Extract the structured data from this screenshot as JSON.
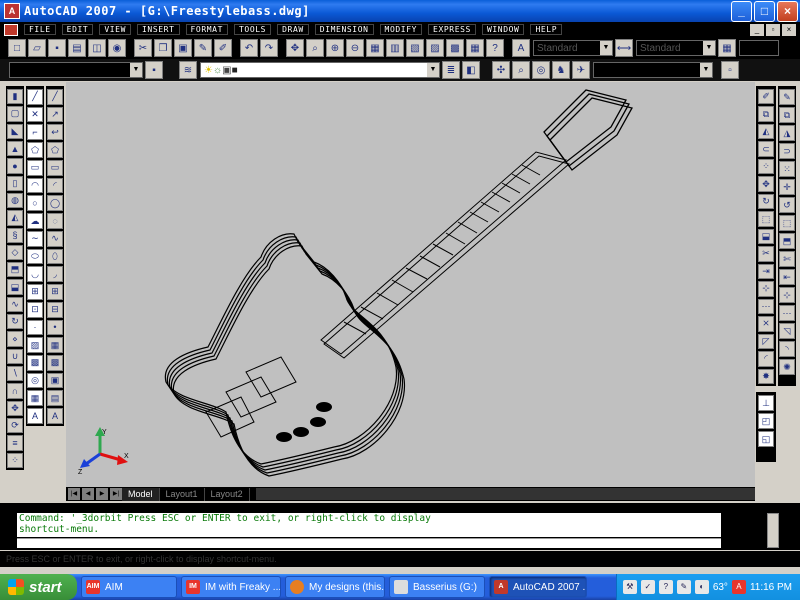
{
  "window": {
    "title": "AutoCAD 2007 - [G:\\Freestylebass.dwg]",
    "app_icon": "A",
    "controls": [
      "_",
      "□",
      "×"
    ]
  },
  "menu": {
    "items": [
      "File",
      "Edit",
      "View",
      "Insert",
      "Format",
      "Tools",
      "Draw",
      "Dimension",
      "Modify",
      "Express",
      "Window",
      "Help"
    ],
    "doc_controls": [
      "_",
      "▫",
      "×"
    ]
  },
  "toolbars": {
    "style_combo": "Standard",
    "dimstyle_combo": "Standard",
    "layer_combo": ""
  },
  "canvas": {
    "background": "#c0c0c0",
    "ucs_labels": {
      "x": "X",
      "y": "Y",
      "z": "Z"
    }
  },
  "layout_tabs": [
    "Model",
    "Layout1",
    "Layout2"
  ],
  "command": {
    "line1": "Command: '_3dorbit Press ESC or ENTER to exit, or right-click to display",
    "line2": "shortcut-menu."
  },
  "status": {
    "text": "Press ESC or ENTER to exit, or right-click to display shortcut-menu."
  },
  "taskbar": {
    "start_label": "start",
    "tasks": [
      {
        "label": "AIM",
        "icon_color": "#e8352c",
        "icon_text": "AIM"
      },
      {
        "label": "IM with Freaky ...",
        "icon_color": "#e8352c",
        "icon_text": "IM"
      },
      {
        "label": "My designs (this...",
        "icon_color": "#e67e22",
        "icon_text": ""
      },
      {
        "label": "Basserius (G:)",
        "icon_color": "#dddddd",
        "icon_text": ""
      },
      {
        "label": "AutoCAD 2007 ...",
        "icon_color": "#c0392b",
        "icon_text": "A"
      }
    ],
    "temperature": "63°",
    "clock": "11:16 PM"
  }
}
